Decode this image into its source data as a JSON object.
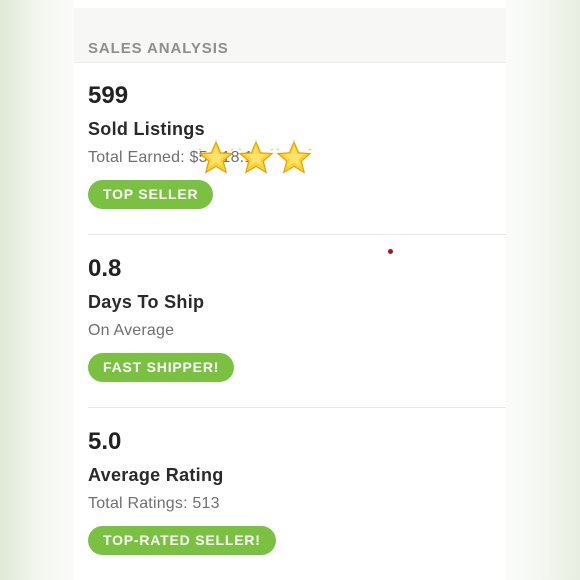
{
  "header": {
    "title": "SALES ANALYSIS"
  },
  "stats": [
    {
      "value": "599",
      "label": "Sold Listings",
      "sub": "Total Earned: $5,318.12",
      "badge": "TOP SELLER"
    },
    {
      "value": "0.8",
      "label": "Days To Ship",
      "sub": "On Average",
      "badge": "FAST SHIPPER!"
    },
    {
      "value": "5.0",
      "label": "Average Rating",
      "sub": "Total Ratings: 513",
      "badge": "TOP-RATED SELLER!"
    }
  ],
  "overlay": {
    "sticker": "three-star-emoji-icon",
    "star_count": 3
  },
  "colors": {
    "badge": "#7ac142",
    "header_text": "#8e8e8e",
    "star": "#ffd22e",
    "dot": "#b3121b"
  }
}
